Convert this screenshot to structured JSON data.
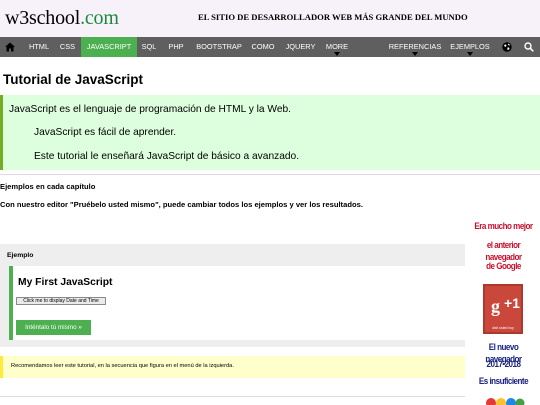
{
  "header": {
    "logo_main": "w3school",
    "logo_suffix": ".com",
    "tagline": "EL SITIO DE DESARROLLADOR WEB MÁS GRANDE DEL MUNDO"
  },
  "nav": {
    "items": [
      {
        "label": "HTML"
      },
      {
        "label": "CSS"
      },
      {
        "label": "JAVASCRIPT"
      },
      {
        "label": "SQL"
      },
      {
        "label": "PHP"
      },
      {
        "label": "BOOTSTRAP"
      },
      {
        "label": "COMO"
      },
      {
        "label": "JQUERY"
      },
      {
        "label": "MORE"
      },
      {
        "label": "REFERENCIAS"
      },
      {
        "label": "EJEMPLOS"
      }
    ],
    "active": "JAVASCRIPT",
    "active_color": "#4caf50",
    "bar_color": "#5f5f5f",
    "icons": [
      "home-icon",
      "globe-icon",
      "search-icon"
    ]
  },
  "main": {
    "title": "Tutorial de JavaScript",
    "intro": [
      "JavaScript es el lenguaje de programación de HTML y la Web.",
      "JavaScript es fácil de aprender.",
      "Este tutorial le enseñará JavaScript de básico a avanzado."
    ],
    "section_heading": "Ejemplos en cada capítulo",
    "section_text": "Con nuestro editor \"Pruébelo usted mismo\", puede cambiar todos los ejemplos y ver los resultados.",
    "example": {
      "label": "Ejemplo",
      "title": "My First JavaScript",
      "demo_button": "Click me to display Date and Time",
      "try_button": "Inténtalo tú mismo »"
    },
    "note": "Recomendamos leer este tutorial, en la secuencia que figura en el menú de la izquierda."
  },
  "ad": {
    "lines_red": [
      "Era mucho mejor",
      "el anterior navegador",
      "de Google"
    ],
    "gplus_caption": "dixit usted hoy",
    "lines_blue": [
      "El nuevo navegador",
      "2017-2018",
      "Es insuficiente"
    ]
  }
}
